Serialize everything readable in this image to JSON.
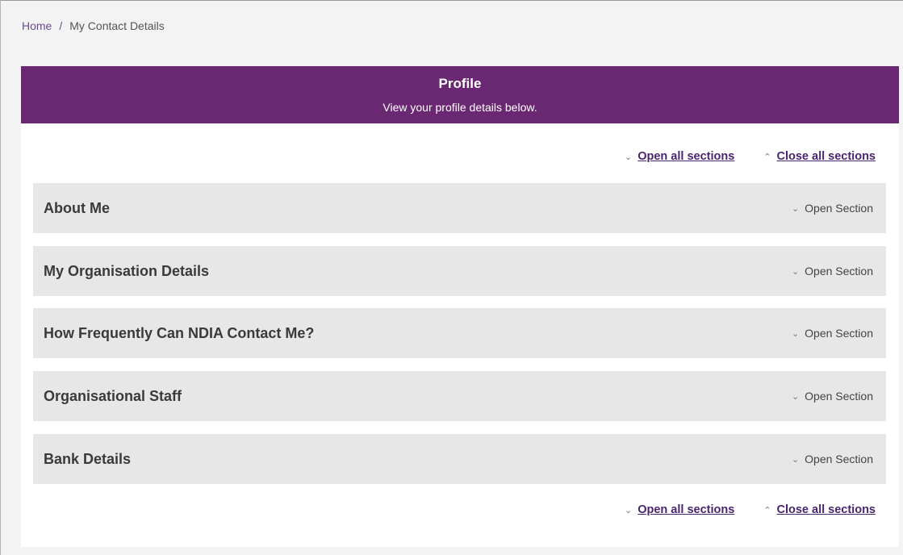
{
  "breadcrumb": {
    "home": "Home",
    "separator": "/",
    "current": "My Contact Details"
  },
  "banner": {
    "title": "Profile",
    "subtitle": "View your profile details below.",
    "color": "#6b2872"
  },
  "controls": {
    "open_all": "Open all sections",
    "close_all": "Close all sections",
    "open_icon": "chevron-down-icon",
    "close_icon": "chevron-up-icon"
  },
  "sections": [
    {
      "title": "About Me",
      "toggle_label": "Open Section"
    },
    {
      "title": "My Organisation Details",
      "toggle_label": "Open Section"
    },
    {
      "title": "How Frequently Can NDIA Contact Me?",
      "toggle_label": "Open Section"
    },
    {
      "title": "Organisational Staff",
      "toggle_label": "Open Section"
    },
    {
      "title": "Bank Details",
      "toggle_label": "Open Section"
    }
  ]
}
